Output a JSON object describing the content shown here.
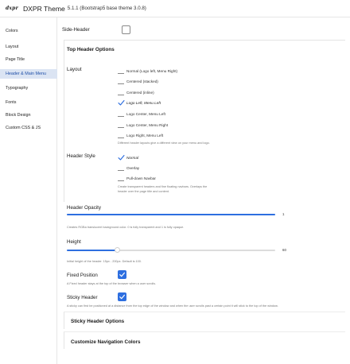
{
  "header": {
    "logo": "dxpr",
    "title": "DXPR Theme",
    "subtitle": "5.1.1 (Bootstrap5 base theme 3.0.8)"
  },
  "sidebar": {
    "items": [
      {
        "label": "Colors",
        "active": false
      },
      {
        "label": "Layout",
        "active": false
      },
      {
        "label": "Page Title",
        "active": false
      },
      {
        "label": "Header & Main Menu",
        "active": true
      },
      {
        "label": "Typography",
        "active": false
      },
      {
        "label": "Fonts",
        "active": false
      },
      {
        "label": "Block Design",
        "active": false
      },
      {
        "label": "Custom CSS & JS",
        "active": false
      }
    ]
  },
  "main": {
    "side_header": {
      "label": "Side-Header",
      "checked": false
    },
    "top_header_options": {
      "title": "Top Header Options",
      "layout": {
        "label": "Layout",
        "options": [
          "Normal (Logo left, Menu Right)",
          "Centered (stacked)",
          "Centered (inline)",
          "Logo Left, Menu Left",
          "Logo Center, Menu Left",
          "Logo Center, Menu Right",
          "Logo Right, Menu Left"
        ],
        "selected": "Logo Left, Menu Left",
        "help": "Different header layouts give a different view on your menu and logo."
      },
      "header_style": {
        "label": "Header Style",
        "options": [
          "Normal",
          "Overlay",
          "Pull-down Navbar"
        ],
        "selected": "Normal",
        "help_line1": "Create transparent headers and fine floating navbars. Overlays the",
        "help_line2": "header over the page title and content."
      }
    },
    "header_opacity": {
      "label": "Header Opacity",
      "value": 1,
      "min": 0,
      "max": 1,
      "value_text": "1",
      "help": "Creates RGBa translucent background color. 0 is fully transparent and 1 is fully opaque."
    },
    "height": {
      "label": "Height",
      "value": 60,
      "min": 15,
      "max": 200,
      "value_text": "60",
      "help": "Initial height of the header. 15px - 200px. Default is 100."
    },
    "fixed_position": {
      "label": "Fixed Position",
      "checked": true,
      "help": "A Fixed header stays at the top of the browser when a user scrolls."
    },
    "sticky_header": {
      "label": "Sticky Header",
      "checked": true,
      "help": "A sticky can first be positioned at a distance from the top edge of the window and when the user scrolls past a certain point it will stick to the top of the window."
    },
    "sticky_header_options": {
      "title": "Sticky Header Options"
    },
    "customize_nav_colors": {
      "title": "Customize Navigation Colors"
    }
  },
  "colors": {
    "accent": "#2e6fe0",
    "active_nav_bg": "#dbe4f3",
    "active_nav_text": "#1f4fa8"
  }
}
